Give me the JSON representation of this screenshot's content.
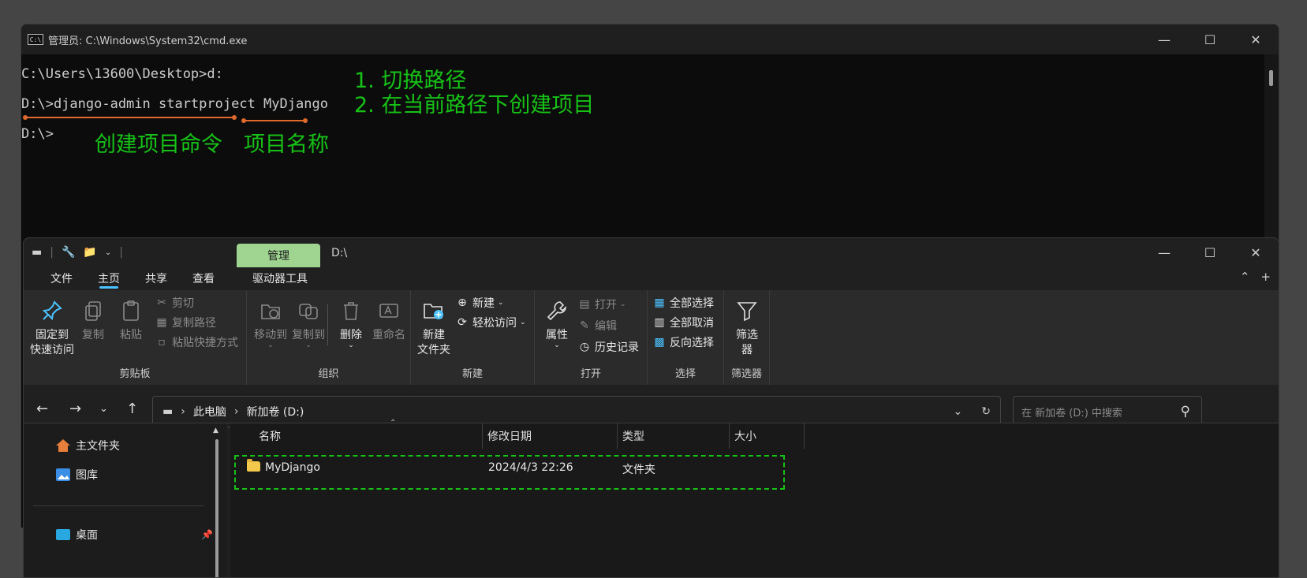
{
  "cmd": {
    "title": "管理员: C:\\Windows\\System32\\cmd.exe",
    "lines": [
      "C:\\Users\\13600\\Desktop>d:",
      "D:\\>django-admin startproject MyDjango",
      "D:\\>"
    ],
    "notes": {
      "step1": "1. 切换路径",
      "step2": "2. 在当前路径下创建项目",
      "label_command": "创建项目命令",
      "label_project": "项目名称"
    },
    "colors": {
      "annotation": "#17c217",
      "underline": "#e06a2c"
    }
  },
  "explorer": {
    "manage_tab": "管理",
    "title_path": "D:\\",
    "menu_tabs": [
      "文件",
      "主页",
      "共享",
      "查看",
      "驱动器工具"
    ],
    "active_tab": "主页",
    "ribbon": {
      "clipboard": {
        "label": "剪贴板",
        "pin": "固定到\n快速访问",
        "copy": "复制",
        "paste": "粘贴",
        "cut": "剪切",
        "copy_path": "复制路径",
        "paste_shortcut": "粘贴快捷方式"
      },
      "organize": {
        "label": "组织",
        "move_to": "移动到",
        "copy_to": "复制到",
        "delete": "删除",
        "rename": "重命名"
      },
      "new": {
        "label": "新建",
        "new_item": "新建",
        "easy_access": "轻松访问",
        "new_folder": "新建\n文件夹"
      },
      "open": {
        "label": "打开",
        "properties": "属性",
        "open": "打开",
        "edit": "编辑",
        "history": "历史记录"
      },
      "select": {
        "label": "选择",
        "select_all": "全部选择",
        "select_none": "全部取消",
        "invert": "反向选择"
      },
      "filter": {
        "label": "筛选器",
        "filter_btn": "筛选\n器"
      }
    },
    "address": {
      "crumbs": [
        "此电脑",
        "新加卷 (D:)"
      ]
    },
    "search": {
      "placeholder": "在 新加卷 (D:) 中搜索"
    },
    "nav": {
      "home": "主文件夹",
      "pictures": "图库",
      "desktop": "桌面"
    },
    "columns": [
      "名称",
      "修改日期",
      "类型",
      "大小"
    ],
    "files": [
      {
        "name": "MyDjango",
        "modified": "2024/4/3 22:26",
        "type": "文件夹",
        "size": ""
      }
    ],
    "colors": {
      "accent": "#4cc2ff",
      "manage_tab": "#9fd591",
      "selection_outline": "#17c217"
    }
  }
}
